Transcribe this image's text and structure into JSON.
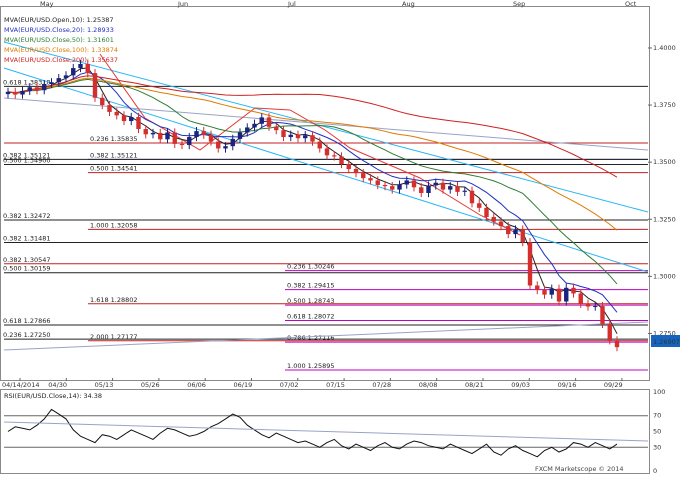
{
  "chart_data": {
    "type": "line",
    "instrument": "EUR/USD",
    "legend": {
      "placement": "top-left",
      "items": [
        {
          "label": "MVA(EUR/USD.Open,10): 1.25387",
          "color": "#222222"
        },
        {
          "label": "MVA(EUR/USD.Close,20): 1.28933",
          "color": "#2030c0"
        },
        {
          "label": "MVA(EUR/USD.Close,50): 1.31601",
          "color": "#2e7d32"
        },
        {
          "label": "MVA(EUR/USD.Close,100): 1.33874",
          "color": "#e07b00"
        },
        {
          "label": "MVA(EUR/USD.Close,200): 1.35637",
          "color": "#d02020"
        }
      ]
    },
    "price_axis": {
      "ylim": [
        1.2555,
        1.4175
      ],
      "ticks": [
        "1.4000",
        "1.3750",
        "1.3500",
        "1.3250",
        "1.3000",
        "1.2750"
      ]
    },
    "last_price": "1.26907",
    "top_months": [
      "May",
      "Jun",
      "Jul",
      "Aug",
      "Sep",
      "Oct"
    ],
    "dates": [
      "04/14/2014",
      "04/30",
      "05/13",
      "05/26",
      "06/06",
      "06/19",
      "07/02",
      "07/15",
      "07/28",
      "08/08",
      "08/21",
      "09/03",
      "09/16",
      "09/29"
    ],
    "levels": [
      {
        "label": "0.618 1.38318",
        "value": 1.3832,
        "color": "#222222"
      },
      {
        "label": "0.236 1.35835",
        "value": 1.3584,
        "color": "#c02020"
      },
      {
        "label": "0.382 1.35121",
        "value": 1.3512,
        "color": "#4040c0"
      },
      {
        "label": "0.382 1.35121",
        "value": 1.3512,
        "color": "#222222"
      },
      {
        "label": "0.500 1.34900",
        "value": 1.349,
        "color": "#222222"
      },
      {
        "label": "0.500 1.34541",
        "value": 1.3454,
        "color": "#c02020"
      },
      {
        "label": "0.382 1.32472",
        "value": 1.3247,
        "color": "#222222"
      },
      {
        "label": "1.000 1.32058",
        "value": 1.3206,
        "color": "#c02020"
      },
      {
        "label": "0.382 1.31481",
        "value": 1.3148,
        "color": "#222222"
      },
      {
        "label": "0.382 1.30547",
        "value": 1.3055,
        "color": "#c02020"
      },
      {
        "label": "0.500 1.30159",
        "value": 1.3016,
        "color": "#222222"
      },
      {
        "label": "0.236 1.30246",
        "value": 1.3025,
        "color": "#c000c0"
      },
      {
        "label": "0.382 1.29415",
        "value": 1.2942,
        "color": "#c000c0"
      },
      {
        "label": "1.618 1.28802",
        "value": 1.288,
        "color": "#c02020"
      },
      {
        "label": "0.500 1.28743",
        "value": 1.2874,
        "color": "#c000c0"
      },
      {
        "label": "0.618 1.28072",
        "value": 1.2807,
        "color": "#c000c0"
      },
      {
        "label": "0.618 1.27866",
        "value": 1.2787,
        "color": "#222222"
      },
      {
        "label": "0.236 1.27250",
        "value": 1.2725,
        "color": "#222222"
      },
      {
        "label": "2.000 1.27177",
        "value": 1.2718,
        "color": "#c02020"
      },
      {
        "label": "0.786 1.27116",
        "value": 1.2712,
        "color": "#c000c0"
      },
      {
        "label": "1.000 1.25895",
        "value": 1.259,
        "color": "#c000c0"
      }
    ],
    "close": [
      1.3808,
      1.3796,
      1.3812,
      1.3828,
      1.3815,
      1.3842,
      1.385,
      1.3868,
      1.388,
      1.3912,
      1.393,
      1.389,
      1.3782,
      1.375,
      1.372,
      1.3705,
      1.368,
      1.3698,
      1.3645,
      1.3622,
      1.3628,
      1.36,
      1.363,
      1.358,
      1.3575,
      1.361,
      1.3636,
      1.362,
      1.359,
      1.356,
      1.357,
      1.3602,
      1.363,
      1.3652,
      1.3668,
      1.3696,
      1.3655,
      1.364,
      1.361,
      1.362,
      1.3605,
      1.3618,
      1.359,
      1.356,
      1.353,
      1.3525,
      1.3492,
      1.347,
      1.3452,
      1.343,
      1.342,
      1.34,
      1.3395,
      1.338,
      1.3402,
      1.342,
      1.339,
      1.3365,
      1.3398,
      1.341,
      1.338,
      1.3395,
      1.337,
      1.3375,
      1.332,
      1.33,
      1.326,
      1.324,
      1.322,
      1.3185,
      1.3205,
      1.315,
      1.296,
      1.294,
      1.292,
      1.2946,
      1.289,
      1.295,
      1.2925,
      1.288,
      1.2868,
      1.287,
      1.2792,
      1.272,
      1.269
    ],
    "rsi": {
      "label": "RSI(EUR/USD.Close,14): 34.38",
      "ylim": [
        0,
        100
      ],
      "ticks": [
        "100",
        "70",
        "50",
        "30",
        "0"
      ],
      "values": [
        50,
        56,
        54,
        52,
        58,
        66,
        78,
        72,
        66,
        52,
        44,
        40,
        36,
        46,
        44,
        40,
        46,
        52,
        48,
        44,
        40,
        48,
        54,
        52,
        48,
        44,
        46,
        50,
        56,
        60,
        66,
        72,
        68,
        58,
        52,
        46,
        42,
        48,
        44,
        40,
        36,
        38,
        34,
        30,
        36,
        40,
        32,
        28,
        34,
        30,
        26,
        32,
        36,
        30,
        28,
        34,
        38,
        36,
        32,
        30,
        28,
        34,
        30,
        26,
        22,
        28,
        34,
        24,
        20,
        28,
        32,
        26,
        22,
        18,
        26,
        30,
        24,
        28,
        36,
        34,
        30,
        36,
        32,
        28,
        34
      ]
    },
    "watermark": "FXCM Marketscope © 2014",
    "grid": false
  }
}
